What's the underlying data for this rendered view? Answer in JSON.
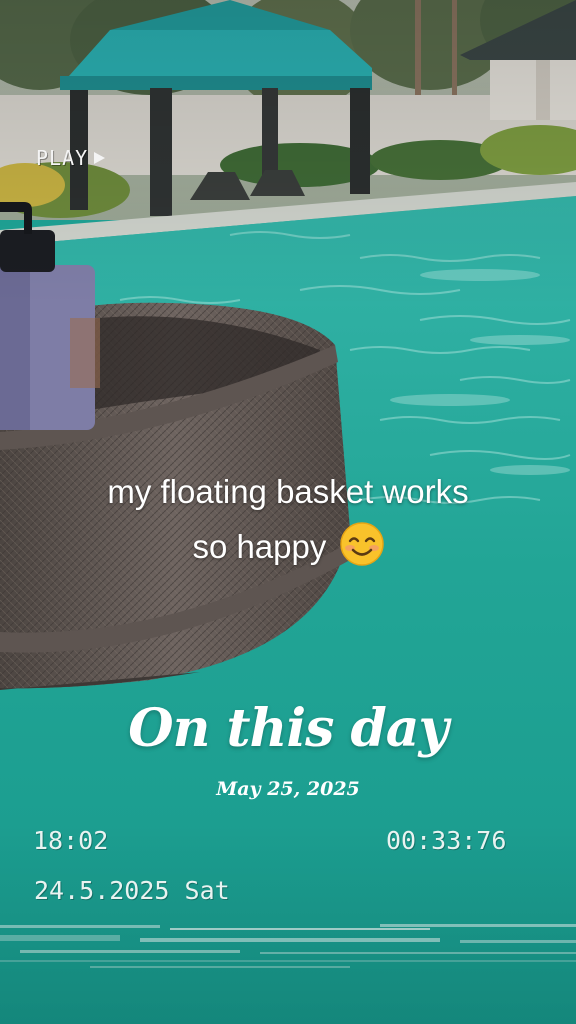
{
  "overlay": {
    "play_label": "PLAY",
    "caption_line1": "my floating basket works",
    "caption_line2": "so happy",
    "caption_emoji": "smiling-face-emoji",
    "title": "On this day",
    "date": "May 25, 2025",
    "time_left": "18:02",
    "time_right": "00:33:76",
    "date_stamp": "24.5.2025 Sat"
  },
  "colors": {
    "pool_water": "#1fa597",
    "gazebo_canopy": "#2bb3b5",
    "basket": "#6b625d",
    "text": "#ffffff"
  },
  "icons": [
    "play-icon",
    "smiling-face-emoji"
  ]
}
